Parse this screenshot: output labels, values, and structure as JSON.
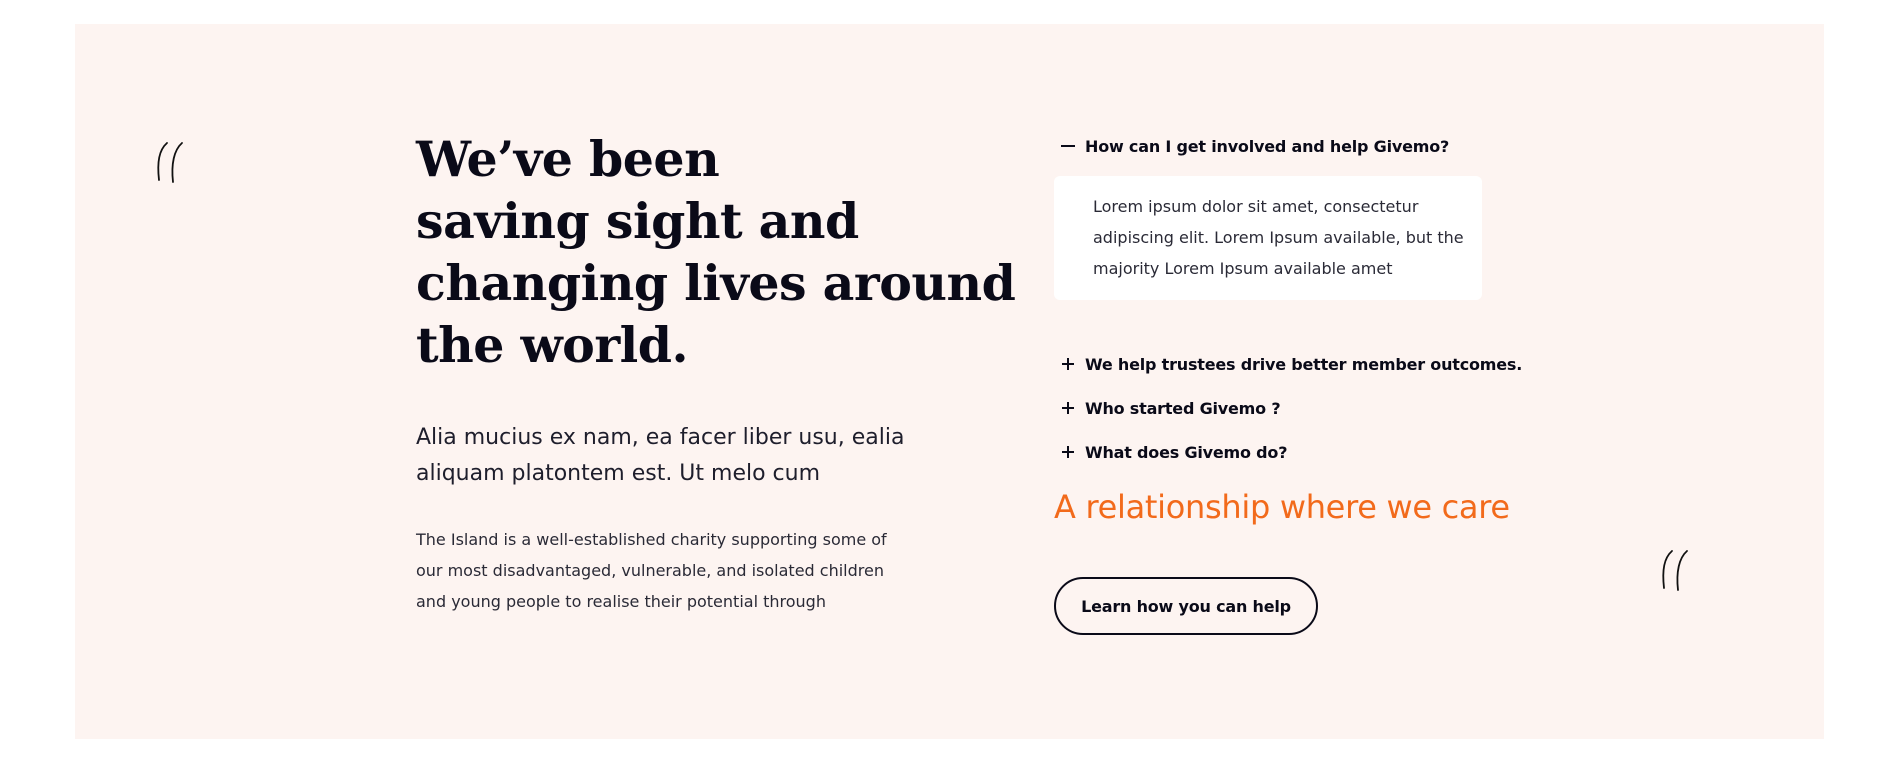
{
  "section": {
    "background_color": "#fdf4f1",
    "accent_color": "#f26a1b",
    "decorations": [
      "quote-mark-icon",
      "quote-mark-icon"
    ]
  },
  "headline": {
    "lines": [
      "We’ve been",
      "saving sight and",
      "changing lives around",
      "the world."
    ]
  },
  "lead": {
    "lines": [
      "Alia mucius ex nam, ea facer liber usu, ealia",
      "aliquam platontem est. Ut melo cum"
    ]
  },
  "body": {
    "lines": [
      "The Island is a well-established charity supporting some of",
      "our most disadvantaged, vulnerable, and isolated children",
      "and young people to realise their potential through"
    ]
  },
  "faq": {
    "open_item": {
      "question": "How can I get involved and help Givemo?",
      "toggle_icon": "minus-icon",
      "answer_lines": [
        "Lorem ipsum dolor sit amet, consectetur",
        "adipiscing elit. Lorem Ipsum available, but the",
        "majority Lorem Ipsum available amet"
      ]
    },
    "items": [
      {
        "question": "We help trustees drive better member outcomes.",
        "toggle_icon": "plus-icon"
      },
      {
        "question": "Who started Givemo ?",
        "toggle_icon": "plus-icon"
      },
      {
        "question": "What does Givemo do?",
        "toggle_icon": "plus-icon"
      }
    ]
  },
  "tagline": "A relationship where we care",
  "cta": {
    "label": "Learn how you can help"
  }
}
